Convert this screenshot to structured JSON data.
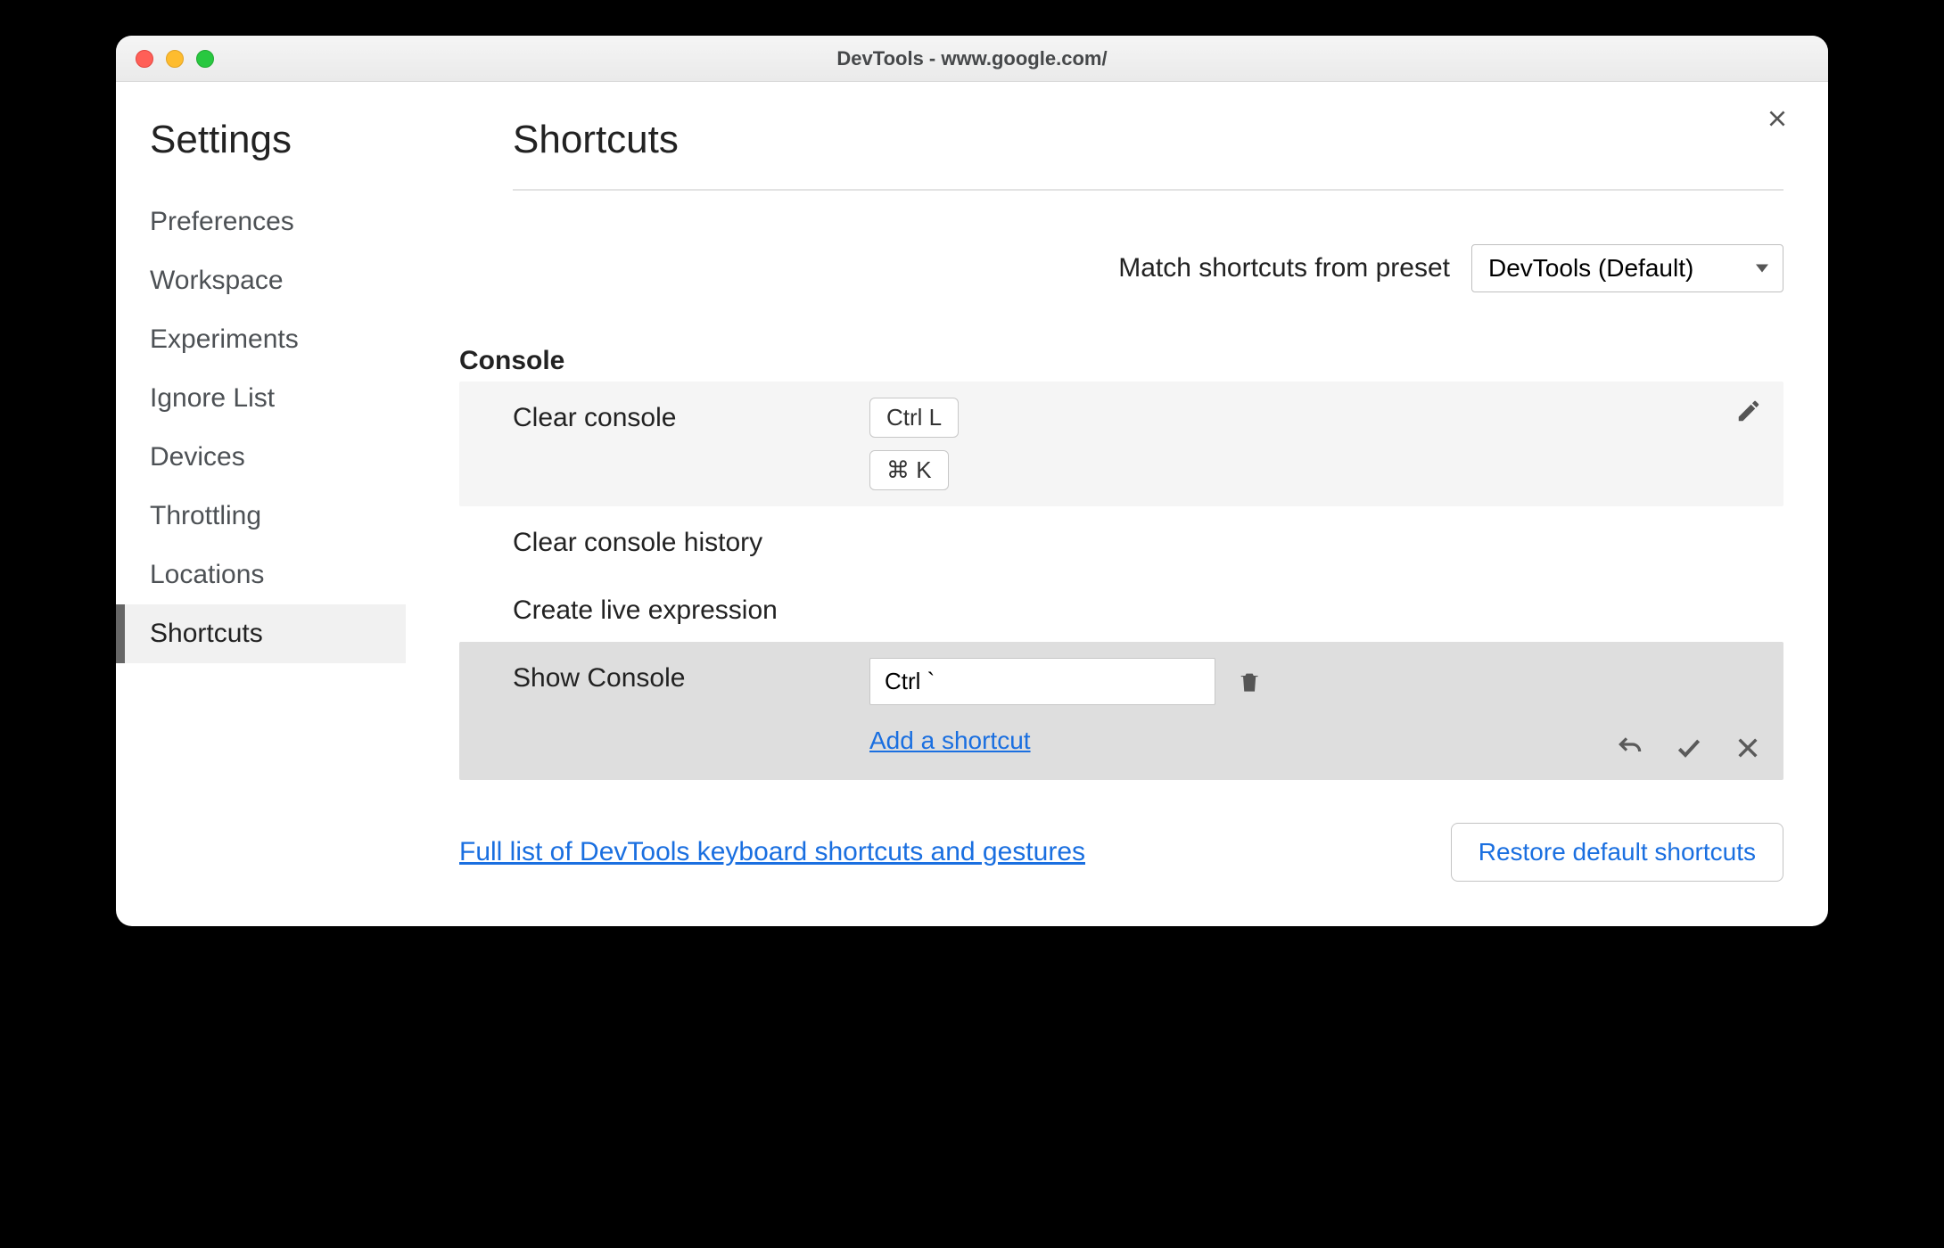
{
  "window": {
    "title": "DevTools - www.google.com/"
  },
  "sidebar": {
    "heading": "Settings",
    "items": [
      {
        "label": "Preferences"
      },
      {
        "label": "Workspace"
      },
      {
        "label": "Experiments"
      },
      {
        "label": "Ignore List"
      },
      {
        "label": "Devices"
      },
      {
        "label": "Throttling"
      },
      {
        "label": "Locations"
      },
      {
        "label": "Shortcuts"
      }
    ],
    "active_index": 7
  },
  "page": {
    "title": "Shortcuts",
    "preset_label": "Match shortcuts from preset",
    "preset_value": "DevTools (Default)"
  },
  "section": {
    "title": "Console",
    "rows": {
      "clear_console": {
        "name": "Clear console",
        "key1": "Ctrl L",
        "key2": "⌘ K"
      },
      "clear_history": {
        "name": "Clear console history"
      },
      "create_live": {
        "name": "Create live expression"
      },
      "show_console": {
        "name": "Show Console",
        "input_value": "Ctrl `",
        "add_label": "Add a shortcut"
      }
    }
  },
  "footer": {
    "doc_link": "Full list of DevTools keyboard shortcuts and gestures",
    "restore_label": "Restore default shortcuts"
  }
}
